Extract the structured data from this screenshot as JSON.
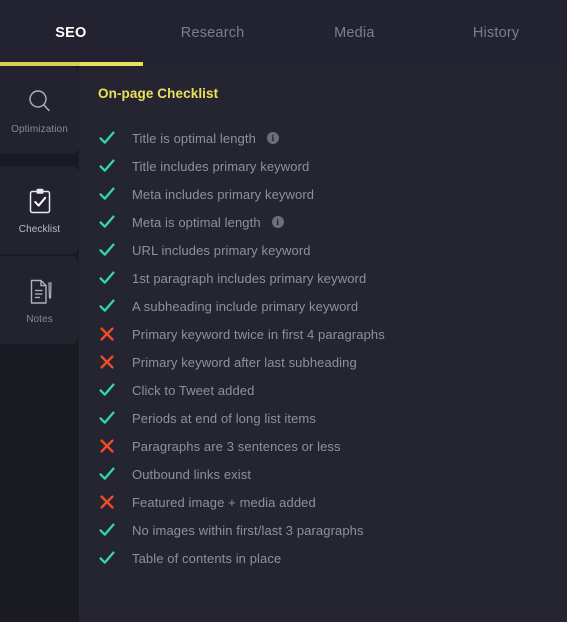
{
  "colors": {
    "accent_yellow": "#ece05a",
    "pass_green": "#35d4b4",
    "fail_red": "#ef4a28",
    "panel_bg": "#252532",
    "sidebar_bg": "#1a1a23",
    "topbar_bg": "#222230",
    "text_muted": "#8e8fa2"
  },
  "tabs": [
    {
      "label": "SEO",
      "active": true
    },
    {
      "label": "Research",
      "active": false
    },
    {
      "label": "Media",
      "active": false
    },
    {
      "label": "History",
      "active": false
    }
  ],
  "sidebar": {
    "items": [
      {
        "label": "Optimization",
        "icon": "magnifier-icon",
        "active": false
      },
      {
        "label": "Checklist",
        "icon": "clipboard-check-icon",
        "active": true
      },
      {
        "label": "Notes",
        "icon": "note-pen-icon",
        "active": false
      }
    ]
  },
  "panel": {
    "title": "On-page Checklist",
    "items": [
      {
        "label": "Title is optimal length",
        "status": "pass",
        "info": true,
        "info_glyph": "i"
      },
      {
        "label": "Title includes primary keyword",
        "status": "pass",
        "info": false
      },
      {
        "label": "Meta includes primary keyword",
        "status": "pass",
        "info": false
      },
      {
        "label": "Meta is optimal length",
        "status": "pass",
        "info": true,
        "info_glyph": "i"
      },
      {
        "label": "URL includes primary keyword",
        "status": "pass",
        "info": false
      },
      {
        "label": "1st paragraph includes primary keyword",
        "status": "pass",
        "info": false
      },
      {
        "label": "A subheading include primary keyword",
        "status": "pass",
        "info": false
      },
      {
        "label": "Primary keyword twice in first 4 paragraphs",
        "status": "fail",
        "info": false
      },
      {
        "label": "Primary keyword after last subheading",
        "status": "fail",
        "info": false
      },
      {
        "label": "Click to Tweet added",
        "status": "pass",
        "info": false
      },
      {
        "label": "Periods at end of long list items",
        "status": "pass",
        "info": false
      },
      {
        "label": "Paragraphs are 3 sentences or less",
        "status": "fail",
        "info": false
      },
      {
        "label": "Outbound links exist",
        "status": "pass",
        "info": false
      },
      {
        "label": "Featured image + media added",
        "status": "fail",
        "info": false
      },
      {
        "label": "No images within first/last 3 paragraphs",
        "status": "pass",
        "info": false
      },
      {
        "label": "Table of contents in place",
        "status": "pass",
        "info": false
      }
    ]
  }
}
